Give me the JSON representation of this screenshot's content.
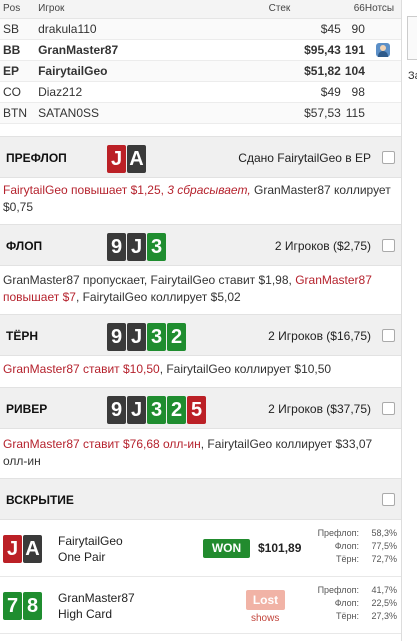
{
  "table": {
    "headers": {
      "pos": "Pos",
      "player": "Игрок",
      "stack": "Стек",
      "bb": "66",
      "notes": "Нотсы"
    },
    "rows": [
      {
        "pos": "SB",
        "name": "drakula110",
        "stack": "$45",
        "bb": "90",
        "bold": false,
        "avatar": false
      },
      {
        "pos": "BB",
        "name": "GranMaster87",
        "stack": "$95,43",
        "bb": "191",
        "bold": true,
        "avatar": true
      },
      {
        "pos": "EP",
        "name": "FairytailGeo",
        "stack": "$51,82",
        "bb": "104",
        "bold": true,
        "avatar": false
      },
      {
        "pos": "CO",
        "name": "Diaz212",
        "stack": "$49",
        "bb": "98",
        "bold": false,
        "avatar": false
      },
      {
        "pos": "BTN",
        "name": "SATAN0SS",
        "stack": "$57,53",
        "bb": "115",
        "bold": false,
        "avatar": false
      }
    ]
  },
  "side": {
    "partial": "За"
  },
  "streets": {
    "preflop": {
      "title": "ПРЕФЛОП",
      "info": "Сдано FairytailGeo в EP",
      "cards": [
        {
          "rank": "J",
          "color": "red"
        },
        {
          "rank": "A",
          "color": "black"
        }
      ]
    },
    "flop": {
      "title": "ФЛОП",
      "info": "2 Игроков ($2,75)",
      "cards": [
        {
          "rank": "9",
          "color": "black"
        },
        {
          "rank": "J",
          "color": "black"
        },
        {
          "rank": "3",
          "color": "green"
        }
      ]
    },
    "turn": {
      "title": "ТЁРН",
      "info": "2 Игроков ($16,75)",
      "cards": [
        {
          "rank": "9",
          "color": "black"
        },
        {
          "rank": "J",
          "color": "black"
        },
        {
          "rank": "3",
          "color": "green"
        },
        {
          "rank": "2",
          "color": "green"
        }
      ]
    },
    "river": {
      "title": "РИВЕР",
      "info": "2 Игроков ($37,75)",
      "cards": [
        {
          "rank": "9",
          "color": "black"
        },
        {
          "rank": "J",
          "color": "black"
        },
        {
          "rank": "3",
          "color": "green"
        },
        {
          "rank": "2",
          "color": "green"
        },
        {
          "rank": "5",
          "color": "red"
        }
      ]
    },
    "showdown": {
      "title": "ВСКРЫТИЕ"
    }
  },
  "actions": {
    "preflop": {
      "a": "FairytailGeo повышает $1,25,",
      "b": " 3 сбрасывает,",
      "c": " GranMaster87 коллирует $0,75"
    },
    "flop": {
      "a": "GranMaster87 пропускает, FairytailGeo ставит $1,98, ",
      "b": "GranMaster87 повышает $7",
      "c": ", FairytailGeo коллирует $5,02"
    },
    "turn": {
      "a": "GranMaster87 ставит $10,50",
      "b": ", FairytailGeo коллирует $10,50"
    },
    "river": {
      "a": "GranMaster87 ставит $76,68 олл-ин",
      "b": ", FairytailGeo коллирует $33,07 олл-ин"
    }
  },
  "results": [
    {
      "name": "FairytailGeo",
      "hand": "One Pair",
      "badge": "WON",
      "amount": "$101,89",
      "cards": [
        {
          "rank": "J",
          "color": "red"
        },
        {
          "rank": "A",
          "color": "black"
        }
      ],
      "equity": [
        {
          "label": "Префлоп:",
          "value": "58,3%"
        },
        {
          "label": "Флоп:",
          "value": "77,5%"
        },
        {
          "label": "Тёрн:",
          "value": "72,7%"
        }
      ]
    },
    {
      "name": "GranMaster87",
      "hand": "High Card",
      "badge": "Lost",
      "shows": "shows",
      "cards": [
        {
          "rank": "7",
          "color": "green"
        },
        {
          "rank": "8",
          "color": "green"
        }
      ],
      "equity": [
        {
          "label": "Префлоп:",
          "value": "41,7%"
        },
        {
          "label": "Флоп:",
          "value": "22,5%"
        },
        {
          "label": "Тёрн:",
          "value": "27,3%"
        }
      ]
    }
  ]
}
